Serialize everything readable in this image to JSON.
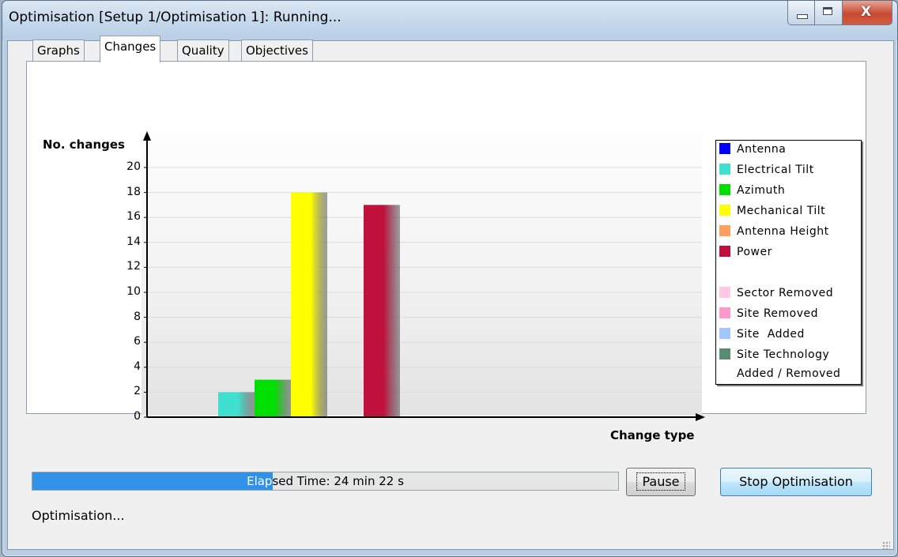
{
  "window": {
    "title": "Optimisation [Setup 1/Optimisation 1]: Running...",
    "close_glyph": "X"
  },
  "tabs": [
    {
      "label": "Graphs",
      "active": false
    },
    {
      "label": "Changes",
      "active": true
    },
    {
      "label": "Quality",
      "active": false
    },
    {
      "label": "Objectives",
      "active": false
    }
  ],
  "chart_data": {
    "type": "bar",
    "ylabel": "No. changes",
    "xlabel": "Change type",
    "ylim": [
      0,
      20
    ],
    "yticks": [
      "20",
      "18",
      "16",
      "14",
      "12",
      "10",
      "8",
      "6",
      "4",
      "2",
      "0"
    ],
    "grid": true,
    "legend_position": "right",
    "series": [
      {
        "name": "Antenna",
        "value": 0,
        "color": "#0000ff"
      },
      {
        "name": "Electrical Tilt",
        "value": 2,
        "color": "#40e0d0"
      },
      {
        "name": "Azimuth",
        "value": 3,
        "color": "#00e000"
      },
      {
        "name": "Mechanical Tilt",
        "value": 18,
        "color": "#ffff00"
      },
      {
        "name": "Antenna Height",
        "value": 0,
        "color": "#ffa060"
      },
      {
        "name": "Power",
        "value": 17,
        "color": "#c0103c"
      },
      {
        "name": "Sector Removed",
        "value": 0,
        "color": "#ffc8e6"
      },
      {
        "name": "Site Removed",
        "value": 0,
        "color": "#ff99cc"
      },
      {
        "name": "Site  Added",
        "value": 0,
        "color": "#a0c8ff"
      },
      {
        "name": "Site Technology Added / Removed",
        "value": 0,
        "color": "#5a8c70"
      }
    ]
  },
  "legend": {
    "items": [
      {
        "label": "Antenna",
        "color": "#0000ff"
      },
      {
        "label": "Electrical Tilt",
        "color": "#40e0d0"
      },
      {
        "label": "Azimuth",
        "color": "#00e000"
      },
      {
        "label": "Mechanical Tilt",
        "color": "#ffff00"
      },
      {
        "label": "Antenna Height",
        "color": "#ffa060"
      },
      {
        "label": "Power",
        "color": "#c0103c"
      },
      {
        "label": "Sector Removed",
        "color": "#ffc8e6"
      },
      {
        "label": "Site Removed",
        "color": "#ff99cc"
      },
      {
        "label": "Site  Added",
        "color": "#a0c8ff"
      },
      {
        "label": "Site Technology",
        "color": "#5a8c70"
      }
    ],
    "continuation": "Added / Removed"
  },
  "progress": {
    "text": "Elapsed Time: 24 min 22 s",
    "fraction": 0.41
  },
  "buttons": {
    "pause": "Pause",
    "stop": "Stop Optimisation"
  },
  "status_text": "Optimisation..."
}
